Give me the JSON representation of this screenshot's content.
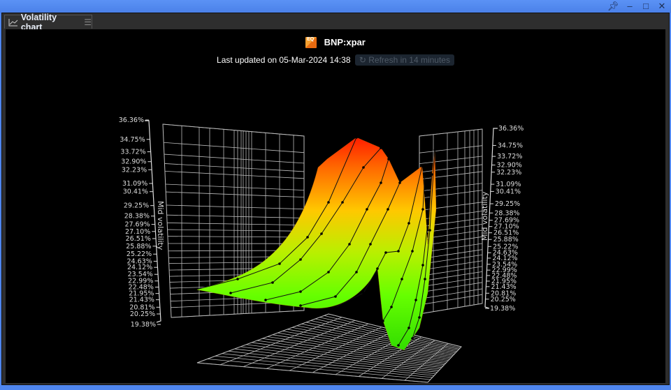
{
  "window": {
    "buttons": {
      "pin": "pin-icon",
      "minimize": "minimize-icon",
      "maximize": "maximize-icon",
      "close": "close-icon"
    }
  },
  "tab": {
    "label": "Volatility chart",
    "icon": "line-chart-icon",
    "menu_icon": "hamburger-menu-icon"
  },
  "header": {
    "badge": "EQ",
    "symbol": "BNP:xpar",
    "last_updated": "Last updated on 05-Mar-2024 14:38",
    "refresh_label": "Refresh in 14 minutes"
  },
  "chart": {
    "type": "3d-surface",
    "z_axis_label": "Mid volatility",
    "z_ticks": [
      "36.36%",
      "34.75%",
      "33.72%",
      "32.90%",
      "32.23%",
      "31.09%",
      "30.41%",
      "29.25%",
      "28.38%",
      "27.69%",
      "27.10%",
      "26.51%",
      "25.88%",
      "25.22%",
      "24.63%",
      "24.12%",
      "23.54%",
      "22.99%",
      "22.48%",
      "21.95%",
      "21.43%",
      "20.81%",
      "20.25%",
      "19.38%"
    ],
    "z_range": [
      19.38,
      36.36
    ],
    "colors": {
      "high": "#ff1a00",
      "mid": "#ffd800",
      "low": "#33e600",
      "grid": "#bbbbbb"
    }
  }
}
